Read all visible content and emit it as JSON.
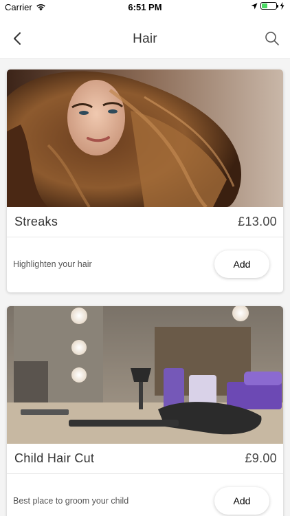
{
  "status_bar": {
    "carrier": "Carrier",
    "time": "6:51 PM",
    "battery_level": 0.4,
    "icons": [
      "wifi-icon",
      "location-arrow-icon",
      "battery-icon",
      "charging-bolt-icon"
    ]
  },
  "nav": {
    "title": "Hair",
    "back_icon": "chevron-left-icon",
    "search_icon": "search-icon"
  },
  "services": [
    {
      "title": "Streaks",
      "price": "£13.00",
      "description": "Highlighten your hair",
      "add_label": "Add"
    },
    {
      "title": "Child Hair Cut",
      "price": "£9.00",
      "description": "Best place to groom your child",
      "add_label": "Add"
    }
  ],
  "colors": {
    "background": "#f4f4f4",
    "card": "#ffffff",
    "battery": "#4cd964"
  }
}
